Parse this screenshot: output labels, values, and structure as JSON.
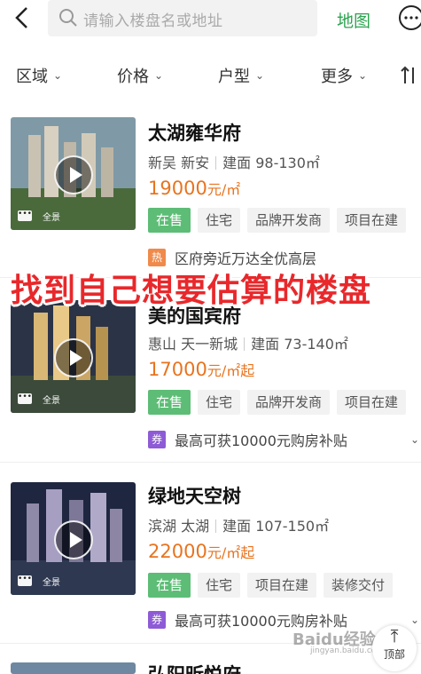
{
  "header": {
    "search_placeholder": "请输入楼盘名或地址",
    "map_label": "地图"
  },
  "filters": [
    {
      "label": "区域"
    },
    {
      "label": "价格"
    },
    {
      "label": "户型"
    },
    {
      "label": "更多"
    }
  ],
  "listings": [
    {
      "name": "太湖雍华府",
      "district": "新吴",
      "area": "新安",
      "size": "建面 98-130㎡",
      "price": "19000",
      "price_unit": "元/㎡",
      "price_suffix": "",
      "tags": [
        "在售",
        "住宅",
        "品牌开发商",
        "项目在建"
      ],
      "promo_badge": "热",
      "promo_text": "区府旁近万达全优高层",
      "promo_color": "#f08a4b"
    },
    {
      "name": "美的国宾府",
      "district": "惠山",
      "area": "天一新城",
      "size": "建面 73-140㎡",
      "price": "17000",
      "price_unit": "元/㎡",
      "price_suffix": "起",
      "tags": [
        "在售",
        "住宅",
        "品牌开发商",
        "项目在建"
      ],
      "promo_badge": "券",
      "promo_text": "最高可获10000元购房补贴",
      "promo_color": "#8e5bd6"
    },
    {
      "name": "绿地天空树",
      "district": "滨湖",
      "area": "太湖",
      "size": "建面 107-150㎡",
      "price": "22000",
      "price_unit": "元/㎡",
      "price_suffix": "起",
      "tags": [
        "在售",
        "住宅",
        "项目在建",
        "装修交付"
      ],
      "promo_badge": "券",
      "promo_text": "最高可获10000元购房补贴",
      "promo_color": "#8e5bd6"
    },
    {
      "name": "弘阳昕悦府"
    }
  ],
  "thumb_labels": {
    "panorama": "全景",
    "more": "•••"
  },
  "overlay_caption": "找到自己想要估算的楼盘",
  "back_to_top": "顶部",
  "watermark": {
    "logo": "Baidu经验",
    "url": "jingyan.baidu.com"
  },
  "colors": {
    "accent_green": "#2ba44f",
    "price_orange": "#e8741f",
    "caption_red": "#e8282b"
  }
}
